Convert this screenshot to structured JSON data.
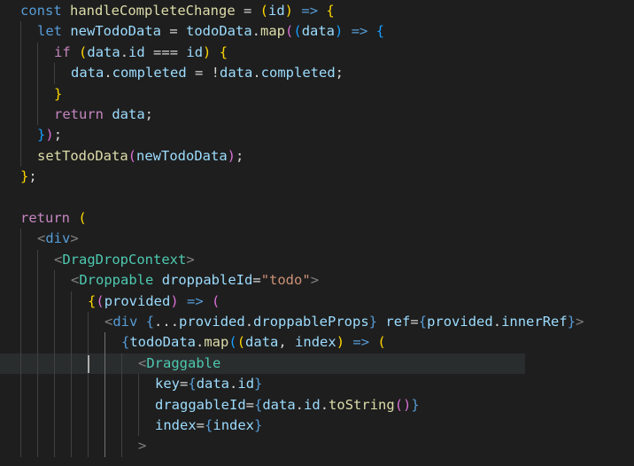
{
  "lines": [
    {
      "indent": 0,
      "tokens": [
        {
          "t": "const",
          "c": "kw"
        },
        {
          "t": " ",
          "c": "pun"
        },
        {
          "t": "handleCompleteChange",
          "c": "fn"
        },
        {
          "t": " = ",
          "c": "pun"
        },
        {
          "t": "(",
          "c": "b1"
        },
        {
          "t": "id",
          "c": "var"
        },
        {
          "t": ")",
          "c": "b1"
        },
        {
          "t": " ",
          "c": "pun"
        },
        {
          "t": "=>",
          "c": "kw"
        },
        {
          "t": " ",
          "c": "pun"
        },
        {
          "t": "{",
          "c": "b1"
        }
      ]
    },
    {
      "indent": 1,
      "tokens": [
        {
          "t": "let",
          "c": "kw"
        },
        {
          "t": " ",
          "c": "pun"
        },
        {
          "t": "newTodoData",
          "c": "var"
        },
        {
          "t": " = ",
          "c": "pun"
        },
        {
          "t": "todoData",
          "c": "var"
        },
        {
          "t": ".",
          "c": "pun"
        },
        {
          "t": "map",
          "c": "fn"
        },
        {
          "t": "(",
          "c": "b2"
        },
        {
          "t": "(",
          "c": "b3"
        },
        {
          "t": "data",
          "c": "var"
        },
        {
          "t": ")",
          "c": "b3"
        },
        {
          "t": " ",
          "c": "pun"
        },
        {
          "t": "=>",
          "c": "kw"
        },
        {
          "t": " ",
          "c": "pun"
        },
        {
          "t": "{",
          "c": "b3"
        }
      ]
    },
    {
      "indent": 2,
      "tokens": [
        {
          "t": "if",
          "c": "ctl"
        },
        {
          "t": " ",
          "c": "pun"
        },
        {
          "t": "(",
          "c": "b1"
        },
        {
          "t": "data",
          "c": "var"
        },
        {
          "t": ".",
          "c": "pun"
        },
        {
          "t": "id",
          "c": "var"
        },
        {
          "t": " === ",
          "c": "pun"
        },
        {
          "t": "id",
          "c": "var"
        },
        {
          "t": ")",
          "c": "b1"
        },
        {
          "t": " ",
          "c": "pun"
        },
        {
          "t": "{",
          "c": "b1"
        }
      ]
    },
    {
      "indent": 3,
      "tokens": [
        {
          "t": "data",
          "c": "var"
        },
        {
          "t": ".",
          "c": "pun"
        },
        {
          "t": "completed",
          "c": "var"
        },
        {
          "t": " = !",
          "c": "pun"
        },
        {
          "t": "data",
          "c": "var"
        },
        {
          "t": ".",
          "c": "pun"
        },
        {
          "t": "completed",
          "c": "var"
        },
        {
          "t": ";",
          "c": "pun"
        }
      ]
    },
    {
      "indent": 2,
      "tokens": [
        {
          "t": "}",
          "c": "b1"
        }
      ]
    },
    {
      "indent": 2,
      "tokens": [
        {
          "t": "return",
          "c": "ctl"
        },
        {
          "t": " ",
          "c": "pun"
        },
        {
          "t": "data",
          "c": "var"
        },
        {
          "t": ";",
          "c": "pun"
        }
      ]
    },
    {
      "indent": 1,
      "tokens": [
        {
          "t": "}",
          "c": "b3"
        },
        {
          "t": ")",
          "c": "b2"
        },
        {
          "t": ";",
          "c": "pun"
        }
      ]
    },
    {
      "indent": 1,
      "tokens": [
        {
          "t": "setTodoData",
          "c": "fn"
        },
        {
          "t": "(",
          "c": "b2"
        },
        {
          "t": "newTodoData",
          "c": "var"
        },
        {
          "t": ")",
          "c": "b2"
        },
        {
          "t": ";",
          "c": "pun"
        }
      ]
    },
    {
      "indent": 0,
      "tokens": [
        {
          "t": "}",
          "c": "b1"
        },
        {
          "t": ";",
          "c": "pun"
        }
      ]
    },
    {
      "indent": 0,
      "tokens": []
    },
    {
      "indent": 0,
      "tokens": [
        {
          "t": "return",
          "c": "ctl"
        },
        {
          "t": " ",
          "c": "pun"
        },
        {
          "t": "(",
          "c": "b1"
        }
      ]
    },
    {
      "indent": 1,
      "tokens": [
        {
          "t": "<",
          "c": "tagb"
        },
        {
          "t": "div",
          "c": "kw"
        },
        {
          "t": ">",
          "c": "tagb"
        }
      ]
    },
    {
      "indent": 2,
      "tokens": [
        {
          "t": "<",
          "c": "tagb"
        },
        {
          "t": "DragDropContext",
          "c": "tag"
        },
        {
          "t": ">",
          "c": "tagb"
        }
      ]
    },
    {
      "indent": 3,
      "tokens": [
        {
          "t": "<",
          "c": "tagb"
        },
        {
          "t": "Droppable",
          "c": "tag"
        },
        {
          "t": " ",
          "c": "pun"
        },
        {
          "t": "droppableId",
          "c": "attr"
        },
        {
          "t": "=",
          "c": "pun"
        },
        {
          "t": "\"todo\"",
          "c": "str"
        },
        {
          "t": ">",
          "c": "tagb"
        }
      ]
    },
    {
      "indent": 4,
      "tokens": [
        {
          "t": "{",
          "c": "b1"
        },
        {
          "t": "(",
          "c": "b2"
        },
        {
          "t": "provided",
          "c": "var"
        },
        {
          "t": ")",
          "c": "b2"
        },
        {
          "t": " ",
          "c": "pun"
        },
        {
          "t": "=>",
          "c": "kw"
        },
        {
          "t": " ",
          "c": "pun"
        },
        {
          "t": "(",
          "c": "b2"
        }
      ]
    },
    {
      "indent": 5,
      "tokens": [
        {
          "t": "<",
          "c": "tagb"
        },
        {
          "t": "div",
          "c": "kw"
        },
        {
          "t": " ",
          "c": "pun"
        },
        {
          "t": "{",
          "c": "kw"
        },
        {
          "t": "...",
          "c": "pun"
        },
        {
          "t": "provided",
          "c": "var"
        },
        {
          "t": ".",
          "c": "pun"
        },
        {
          "t": "droppableProps",
          "c": "var"
        },
        {
          "t": "}",
          "c": "kw"
        },
        {
          "t": " ",
          "c": "pun"
        },
        {
          "t": "ref",
          "c": "attr"
        },
        {
          "t": "=",
          "c": "pun"
        },
        {
          "t": "{",
          "c": "kw"
        },
        {
          "t": "provided",
          "c": "var"
        },
        {
          "t": ".",
          "c": "pun"
        },
        {
          "t": "innerRef",
          "c": "var"
        },
        {
          "t": "}",
          "c": "kw"
        },
        {
          "t": ">",
          "c": "tagb"
        }
      ]
    },
    {
      "indent": 6,
      "tokens": [
        {
          "t": "{",
          "c": "kw"
        },
        {
          "t": "todoData",
          "c": "var"
        },
        {
          "t": ".",
          "c": "pun"
        },
        {
          "t": "map",
          "c": "fn"
        },
        {
          "t": "(",
          "c": "b3"
        },
        {
          "t": "(",
          "c": "b1"
        },
        {
          "t": "data",
          "c": "var"
        },
        {
          "t": ", ",
          "c": "pun"
        },
        {
          "t": "index",
          "c": "var"
        },
        {
          "t": ")",
          "c": "b1"
        },
        {
          "t": " ",
          "c": "pun"
        },
        {
          "t": "=>",
          "c": "kw"
        },
        {
          "t": " ",
          "c": "pun"
        },
        {
          "t": "(",
          "c": "b1"
        }
      ]
    },
    {
      "indent": 7,
      "current": true,
      "tokens": [
        {
          "t": "<",
          "c": "tagb"
        },
        {
          "t": "Draggable",
          "c": "tag"
        }
      ]
    },
    {
      "indent": 8,
      "tokens": [
        {
          "t": "key",
          "c": "attr"
        },
        {
          "t": "=",
          "c": "pun"
        },
        {
          "t": "{",
          "c": "kw"
        },
        {
          "t": "data",
          "c": "var"
        },
        {
          "t": ".",
          "c": "pun"
        },
        {
          "t": "id",
          "c": "var"
        },
        {
          "t": "}",
          "c": "kw"
        }
      ]
    },
    {
      "indent": 8,
      "tokens": [
        {
          "t": "draggableId",
          "c": "attr"
        },
        {
          "t": "=",
          "c": "pun"
        },
        {
          "t": "{",
          "c": "kw"
        },
        {
          "t": "data",
          "c": "var"
        },
        {
          "t": ".",
          "c": "pun"
        },
        {
          "t": "id",
          "c": "var"
        },
        {
          "t": ".",
          "c": "pun"
        },
        {
          "t": "toString",
          "c": "fn"
        },
        {
          "t": "()",
          "c": "b2"
        },
        {
          "t": "}",
          "c": "kw"
        }
      ]
    },
    {
      "indent": 8,
      "tokens": [
        {
          "t": "index",
          "c": "attr"
        },
        {
          "t": "=",
          "c": "pun"
        },
        {
          "t": "{",
          "c": "kw"
        },
        {
          "t": "index",
          "c": "var"
        },
        {
          "t": "}",
          "c": "kw"
        }
      ]
    },
    {
      "indent": 7,
      "tokens": [
        {
          "t": ">",
          "c": "tagb"
        }
      ]
    }
  ]
}
